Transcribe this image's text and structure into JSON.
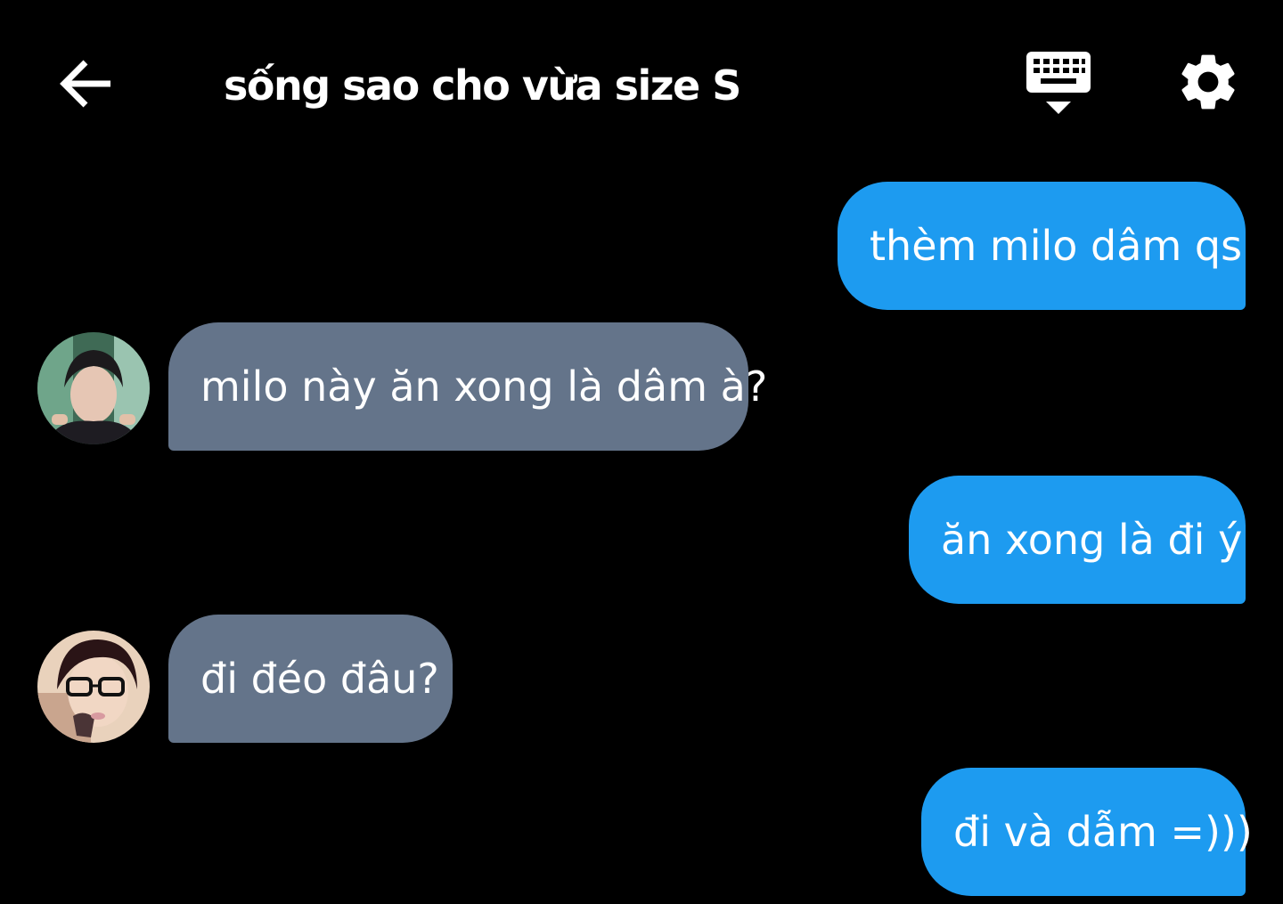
{
  "header": {
    "back_icon": "arrow-left-icon",
    "title": "sống sao cho vừa size S",
    "keyboard_icon": "keyboard-hide-icon",
    "settings_icon": "gear-icon"
  },
  "messages": [
    {
      "direction": "outgoing",
      "text": "thèm milo dâm qs"
    },
    {
      "direction": "incoming",
      "text": "milo này ăn xong là dâm à?",
      "avatar": "avatar-1"
    },
    {
      "direction": "outgoing",
      "text": "ăn xong là đi ý"
    },
    {
      "direction": "incoming",
      "text": "đi đéo đâu?",
      "avatar": "avatar-2"
    },
    {
      "direction": "outgoing",
      "text": "đi và dẫm =)))"
    }
  ],
  "colors": {
    "background": "#000000",
    "outgoing_bubble": "#1d9bf0",
    "incoming_bubble": "#64748a",
    "text": "#ffffff"
  }
}
